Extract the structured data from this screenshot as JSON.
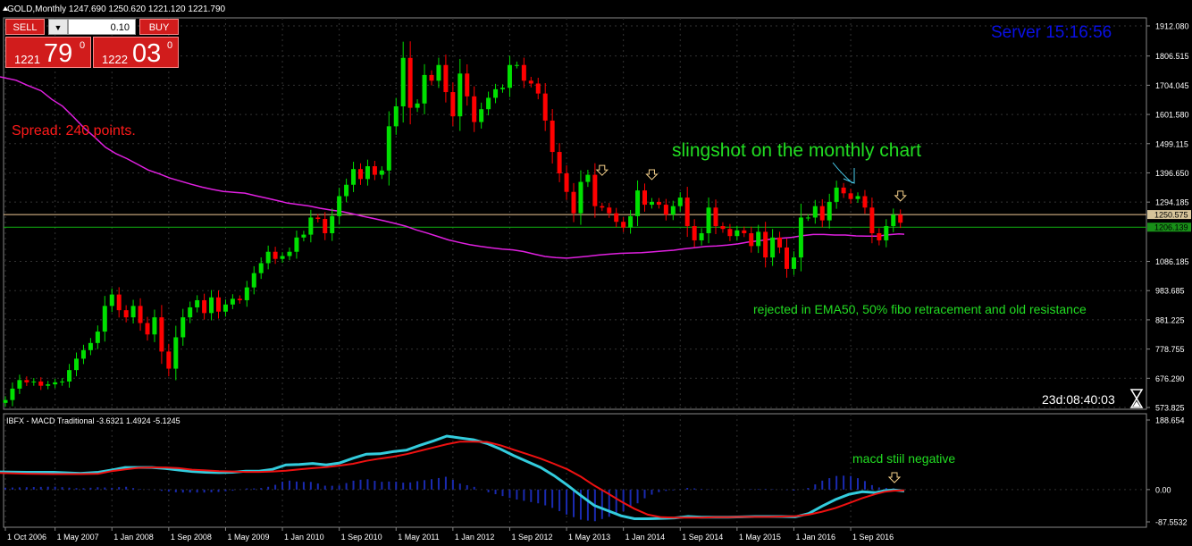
{
  "header": {
    "symbol_label": "GOLD,Monthly",
    "ohlc": "1247.690 1250.620 1221.120 1221.790"
  },
  "trade_panel": {
    "sell_label": "SELL",
    "buy_label": "BUY",
    "lot_value": "0.10",
    "lot_arrow": "▼",
    "bid_small": "1221",
    "bid_big": "79",
    "bid_sup": "0",
    "ask_small": "1222",
    "ask_big": "03",
    "ask_sup": "0"
  },
  "overlay": {
    "server_label": "Server  15:16:56",
    "spread_label": "Spread: 240 points.",
    "timer_label": "23d:08:40:03",
    "timer_icon": "hourglass-icon"
  },
  "annotations": {
    "slingshot": "slingshot on the monthly chart",
    "rejected": "rejected in EMA50, 50% fibo retracement and old resistance",
    "macd_note": "macd stiil negative"
  },
  "macd_panel": {
    "label": "IBFX - MACD Traditional -3.6321 1.4924 -5.1245"
  },
  "colors": {
    "bull": "#00e000",
    "bear": "#ff0000",
    "ema": "#e020e0",
    "macd_line": "#33ccdd",
    "signal_line": "#ee1111",
    "histogram": "#1a2ab0",
    "annotation": "#22dd22",
    "server": "#0a10e6"
  },
  "chart_data": [
    {
      "type": "candlestick",
      "title": "GOLD,Monthly",
      "ylim": [
        573.825,
        1912.08
      ],
      "y_ticks": [
        "1912.080",
        "1806.515",
        "1704.045",
        "1601.580",
        "1499.115",
        "1396.650",
        "1294.185",
        "1250.575",
        "1206.139",
        "1086.185",
        "983.685",
        "881.225",
        "778.755",
        "676.290",
        "573.825"
      ],
      "x_ticks": [
        "1 Oct 2006",
        "1 May 2007",
        "1 Jan 2008",
        "1 Sep 2008",
        "1 May 2009",
        "1 Jan 2010",
        "1 Sep 2010",
        "1 May 2011",
        "1 Jan 2012",
        "1 Sep 2012",
        "1 May 2013",
        "1 Jan 2014",
        "1 Sep 2014",
        "1 May 2015",
        "1 Jan 2016",
        "1 Sep 2016"
      ],
      "x_tick_months": [
        0,
        7,
        15,
        23,
        31,
        39,
        47,
        55,
        63,
        71,
        79,
        87,
        95,
        103,
        111,
        119
      ],
      "levels": [
        {
          "value": 1250.575,
          "label": "1250.575"
        },
        {
          "value": 1206.139,
          "label": "1206.139"
        }
      ],
      "start_month": "Oct 2006",
      "closes": [
        600,
        640,
        670,
        662,
        665,
        650,
        655,
        662,
        665,
        705,
        745,
        775,
        800,
        840,
        930,
        970,
        915,
        890,
        930,
        870,
        830,
        890,
        770,
        710,
        820,
        890,
        925,
        950,
        905,
        960,
        910,
        935,
        955,
        950,
        995,
        1045,
        1080,
        1120,
        1095,
        1105,
        1120,
        1170,
        1180,
        1240,
        1235,
        1185,
        1245,
        1315,
        1355,
        1410,
        1375,
        1420,
        1390,
        1405,
        1560,
        1630,
        1800,
        1625,
        1640,
        1740,
        1720,
        1775,
        1680,
        1595,
        1745,
        1665,
        1575,
        1620,
        1660,
        1690,
        1695,
        1775,
        1775,
        1720,
        1710,
        1675,
        1580,
        1470,
        1395,
        1330,
        1255,
        1365,
        1390,
        1280,
        1275,
        1255,
        1225,
        1205,
        1245,
        1335,
        1285,
        1295,
        1285,
        1250,
        1280,
        1310,
        1210,
        1160,
        1185,
        1275,
        1210,
        1200,
        1175,
        1195,
        1185,
        1140,
        1190,
        1100,
        1170,
        1135,
        1060,
        1100,
        1240,
        1240,
        1280,
        1230,
        1295,
        1345,
        1325,
        1305,
        1315,
        1275,
        1185,
        1160,
        1210,
        1250,
        1221.79
      ],
      "ema50": [
        [
          0,
          483
        ],
        [
          18,
          471
        ],
        [
          30,
          454
        ],
        [
          46,
          434
        ],
        [
          58,
          404
        ],
        [
          70,
          380
        ],
        [
          82,
          343
        ],
        [
          94,
          304
        ],
        [
          106,
          271
        ],
        [
          118,
          236
        ],
        [
          130,
          213
        ],
        [
          142,
          196
        ],
        [
          154,
          176
        ],
        [
          166,
          156
        ],
        [
          178,
          143
        ],
        [
          190,
          128
        ],
        [
          202,
          117
        ],
        [
          214,
          106
        ],
        [
          226,
          96
        ],
        [
          238,
          88
        ],
        [
          250,
          81
        ],
        [
          262,
          78
        ],
        [
          274,
          75
        ],
        [
          286,
          66
        ],
        [
          298,
          58
        ],
        [
          310,
          49
        ],
        [
          322,
          40
        ],
        [
          334,
          35
        ],
        [
          346,
          30
        ],
        [
          358,
          22
        ],
        [
          370,
          16
        ],
        [
          382,
          11
        ],
        [
          394,
          3
        ],
        [
          406,
          -6
        ],
        [
          418,
          -14
        ],
        [
          430,
          -22
        ],
        [
          442,
          -31
        ],
        [
          454,
          -41
        ],
        [
          466,
          -54
        ],
        [
          478,
          -65
        ],
        [
          490,
          -77
        ],
        [
          502,
          -89
        ],
        [
          514,
          -98
        ],
        [
          526,
          -106
        ],
        [
          538,
          -112
        ],
        [
          550,
          -117
        ],
        [
          562,
          -121
        ],
        [
          574,
          -124
        ],
        [
          586,
          -130
        ],
        [
          598,
          -139
        ],
        [
          610,
          -147
        ],
        [
          622,
          -151
        ],
        [
          634,
          -153
        ],
        [
          646,
          -150
        ],
        [
          658,
          -146
        ],
        [
          670,
          -142
        ],
        [
          682,
          -139
        ],
        [
          694,
          -136
        ],
        [
          706,
          -135
        ],
        [
          718,
          -134
        ],
        [
          730,
          -131
        ],
        [
          742,
          -128
        ],
        [
          754,
          -125
        ],
        [
          766,
          -120
        ],
        [
          778,
          -116
        ],
        [
          790,
          -112
        ],
        [
          802,
          -110
        ],
        [
          814,
          -107
        ],
        [
          826,
          -103
        ],
        [
          838,
          -96
        ],
        [
          850,
          -92
        ],
        [
          862,
          -87
        ],
        [
          874,
          -83
        ],
        [
          886,
          -80
        ],
        [
          898,
          -74
        ],
        [
          910,
          -70
        ],
        [
          922,
          -70
        ],
        [
          934,
          -72
        ],
        [
          946,
          -72
        ],
        [
          958,
          -75
        ],
        [
          970,
          -76
        ],
        [
          982,
          -76
        ],
        [
          994,
          -71
        ],
        [
          1006,
          -68
        ],
        [
          1012,
          -69
        ]
      ]
    },
    {
      "type": "macd",
      "title": "IBFX - MACD Traditional -3.6321 1.4924 -5.1245",
      "ylim": [
        -87.5532,
        188.654
      ],
      "y_ticks": [
        "188.654",
        "0.00",
        "-87.5532"
      ],
      "macd": [
        [
          0,
          48
        ],
        [
          30,
          47
        ],
        [
          60,
          47
        ],
        [
          90,
          44
        ],
        [
          110,
          47
        ],
        [
          125,
          53
        ],
        [
          140,
          60
        ],
        [
          155,
          60
        ],
        [
          170,
          60
        ],
        [
          185,
          57
        ],
        [
          200,
          53
        ],
        [
          215,
          49
        ],
        [
          230,
          47
        ],
        [
          245,
          46
        ],
        [
          260,
          47
        ],
        [
          275,
          50
        ],
        [
          290,
          50
        ],
        [
          305,
          55
        ],
        [
          320,
          67
        ],
        [
          335,
          68
        ],
        [
          350,
          71
        ],
        [
          365,
          67
        ],
        [
          380,
          72
        ],
        [
          395,
          85
        ],
        [
          410,
          96
        ],
        [
          425,
          97
        ],
        [
          440,
          103
        ],
        [
          455,
          107
        ],
        [
          470,
          120
        ],
        [
          485,
          132
        ],
        [
          500,
          145
        ],
        [
          515,
          140
        ],
        [
          530,
          135
        ],
        [
          545,
          125
        ],
        [
          560,
          110
        ],
        [
          575,
          92
        ],
        [
          590,
          76
        ],
        [
          605,
          60
        ],
        [
          620,
          38
        ],
        [
          635,
          12
        ],
        [
          650,
          -16
        ],
        [
          665,
          -43
        ],
        [
          680,
          -57
        ],
        [
          695,
          -71
        ],
        [
          710,
          -79
        ],
        [
          725,
          -79
        ],
        [
          740,
          -78
        ],
        [
          755,
          -77
        ],
        [
          770,
          -73
        ],
        [
          785,
          -75
        ],
        [
          800,
          -75
        ],
        [
          815,
          -75
        ],
        [
          830,
          -74
        ],
        [
          845,
          -73
        ],
        [
          860,
          -73
        ],
        [
          875,
          -73
        ],
        [
          890,
          -74
        ],
        [
          905,
          -65
        ],
        [
          920,
          -45
        ],
        [
          935,
          -27
        ],
        [
          950,
          -13
        ],
        [
          965,
          -6
        ],
        [
          980,
          -8
        ],
        [
          990,
          -3
        ],
        [
          1000,
          -1
        ],
        [
          1012,
          -4
        ]
      ],
      "signal": [
        [
          0,
          45
        ],
        [
          30,
          43
        ],
        [
          60,
          42
        ],
        [
          90,
          42
        ],
        [
          110,
          43
        ],
        [
          125,
          50
        ],
        [
          140,
          55
        ],
        [
          155,
          59
        ],
        [
          170,
          60
        ],
        [
          185,
          60
        ],
        [
          200,
          58
        ],
        [
          215,
          54
        ],
        [
          230,
          52
        ],
        [
          245,
          50
        ],
        [
          260,
          49
        ],
        [
          275,
          48
        ],
        [
          290,
          48
        ],
        [
          305,
          49
        ],
        [
          320,
          51
        ],
        [
          335,
          55
        ],
        [
          350,
          58
        ],
        [
          365,
          61
        ],
        [
          380,
          65
        ],
        [
          395,
          70
        ],
        [
          410,
          78
        ],
        [
          425,
          84
        ],
        [
          440,
          89
        ],
        [
          455,
          96
        ],
        [
          470,
          105
        ],
        [
          485,
          114
        ],
        [
          500,
          123
        ],
        [
          515,
          130
        ],
        [
          530,
          130
        ],
        [
          545,
          129
        ],
        [
          560,
          120
        ],
        [
          575,
          108
        ],
        [
          590,
          96
        ],
        [
          605,
          84
        ],
        [
          620,
          70
        ],
        [
          635,
          55
        ],
        [
          650,
          35
        ],
        [
          665,
          11
        ],
        [
          680,
          -10
        ],
        [
          695,
          -32
        ],
        [
          710,
          -52
        ],
        [
          725,
          -68
        ],
        [
          740,
          -75
        ],
        [
          755,
          -76
        ],
        [
          770,
          -76
        ],
        [
          785,
          -76
        ],
        [
          800,
          -75
        ],
        [
          815,
          -75
        ],
        [
          830,
          -74
        ],
        [
          845,
          -74
        ],
        [
          860,
          -74
        ],
        [
          875,
          -73
        ],
        [
          890,
          -72
        ],
        [
          905,
          -68
        ],
        [
          920,
          -60
        ],
        [
          935,
          -50
        ],
        [
          950,
          -37
        ],
        [
          965,
          -23
        ],
        [
          980,
          -12
        ],
        [
          990,
          -6
        ],
        [
          1000,
          -3
        ],
        [
          1012,
          -2
        ]
      ]
    }
  ]
}
